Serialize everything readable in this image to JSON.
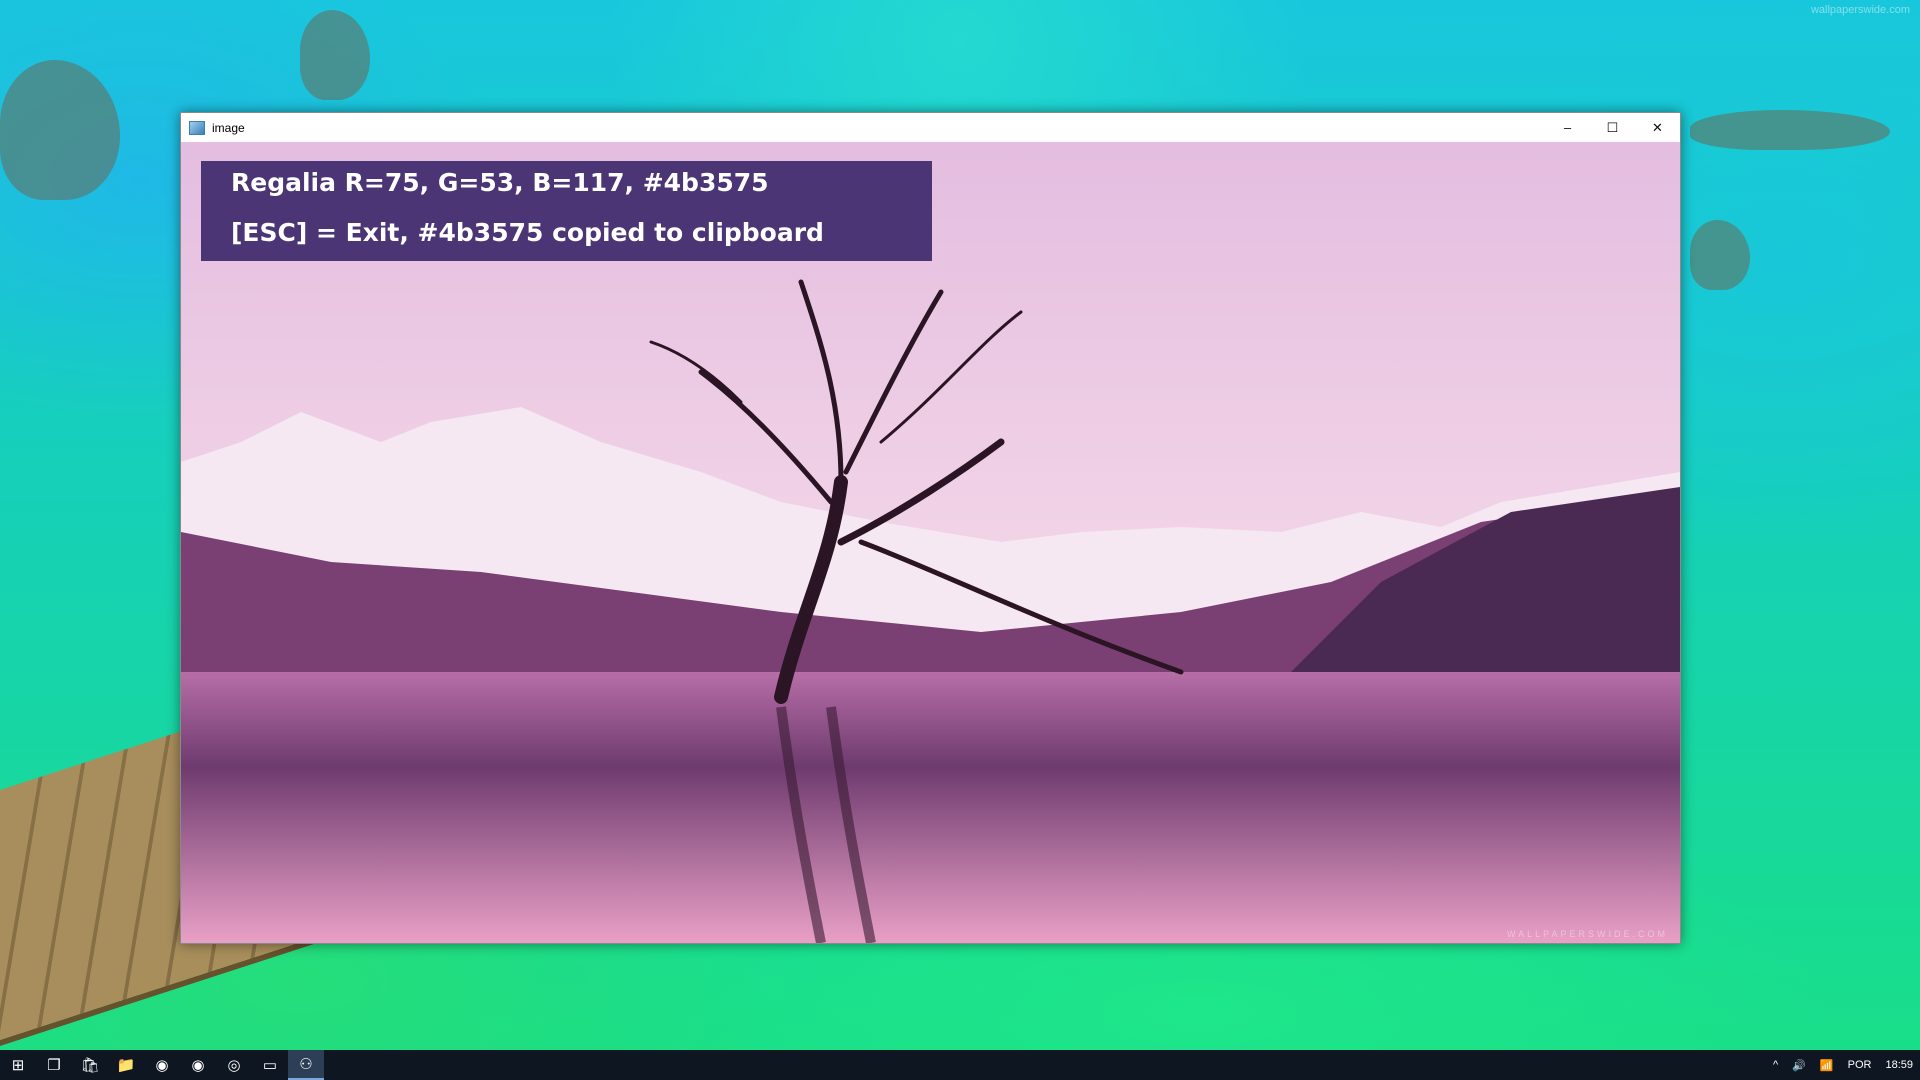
{
  "desktop": {
    "watermark": "wallpaperswide.com"
  },
  "window": {
    "title": "image",
    "controls": {
      "minimize": "–",
      "maximize": "☐",
      "close": "✕"
    },
    "overlay": {
      "line1": "Regalia R=75, G=53, B=117, #4b3575",
      "line2": "[ESC] = Exit, #4b3575 copied to clipboard",
      "background_color": "#4b3575"
    },
    "image_watermark": "WALLPAPERSWIDE.COM"
  },
  "taskbar": {
    "apps": [
      {
        "name": "start-button",
        "glyph": "⊞"
      },
      {
        "name": "task-view-button",
        "glyph": "❐"
      },
      {
        "name": "store-app",
        "glyph": "🛍"
      },
      {
        "name": "file-explorer-app",
        "glyph": "📁"
      },
      {
        "name": "chrome-app",
        "glyph": "◉"
      },
      {
        "name": "chrome-app-2",
        "glyph": "◉"
      },
      {
        "name": "tor-app",
        "glyph": "◎"
      },
      {
        "name": "terminal-app",
        "glyph": "▭"
      },
      {
        "name": "python-app",
        "glyph": "⚇"
      }
    ],
    "tray": {
      "chevron": "^",
      "volume": "🔊",
      "network": "📶",
      "language": "POR",
      "time": "18:59"
    }
  }
}
